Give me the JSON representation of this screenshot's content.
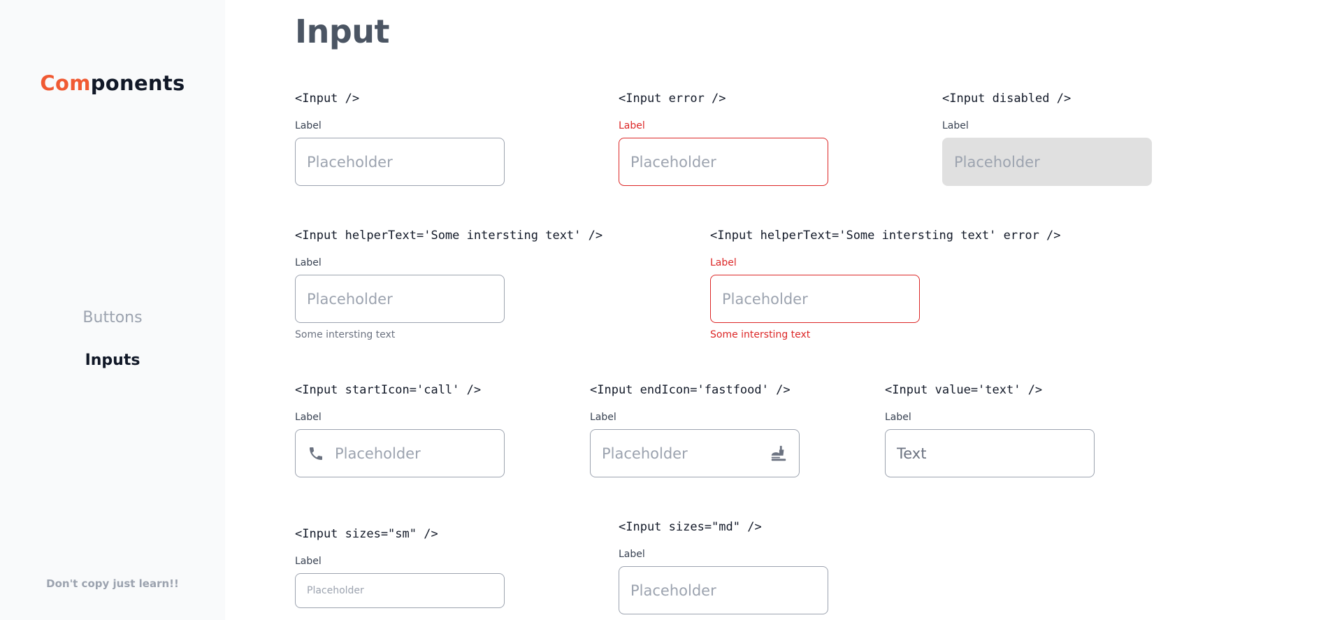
{
  "sidebar": {
    "logo_accent": "Com",
    "logo_rest": "ponents",
    "nav": [
      {
        "label": "Buttons",
        "active": false
      },
      {
        "label": "Inputs",
        "active": true
      }
    ],
    "footer_note": "Don't copy just learn!!"
  },
  "page": {
    "title": "Input"
  },
  "demos": [
    {
      "code": "<Input />",
      "label": "Label",
      "placeholder": "Placeholder"
    },
    {
      "code": "<Input error />",
      "label": "Label",
      "placeholder": "Placeholder"
    },
    {
      "code": "<Input disabled />",
      "label": "Label",
      "placeholder": "Placeholder"
    },
    {
      "code": "<Input helperText='Some intersting text' />",
      "label": "Label",
      "placeholder": "Placeholder",
      "helper": "Some intersting text"
    },
    {
      "code": "<Input helperText='Some intersting text' error />",
      "label": "Label",
      "placeholder": "Placeholder",
      "helper": "Some intersting text"
    },
    {
      "code": "<Input startIcon='call' />",
      "label": "Label",
      "placeholder": "Placeholder",
      "icon": "call-icon"
    },
    {
      "code": "<Input endIcon='fastfood' />",
      "label": "Label",
      "placeholder": "Placeholder",
      "icon": "fastfood-icon"
    },
    {
      "code": "<Input value='text' />",
      "label": "Label",
      "value": "Text"
    },
    {
      "code": "<Input sizes=\"sm\" />",
      "label": "Label",
      "placeholder": "Placeholder"
    },
    {
      "code": "<Input sizes=\"md\" />",
      "label": "Label",
      "placeholder": "Placeholder"
    }
  ],
  "colors": {
    "accent": "#f05a33",
    "error": "#dc2626",
    "sidebar_bg": "#f9fafb",
    "disabled_bg": "#e0e0e0"
  }
}
